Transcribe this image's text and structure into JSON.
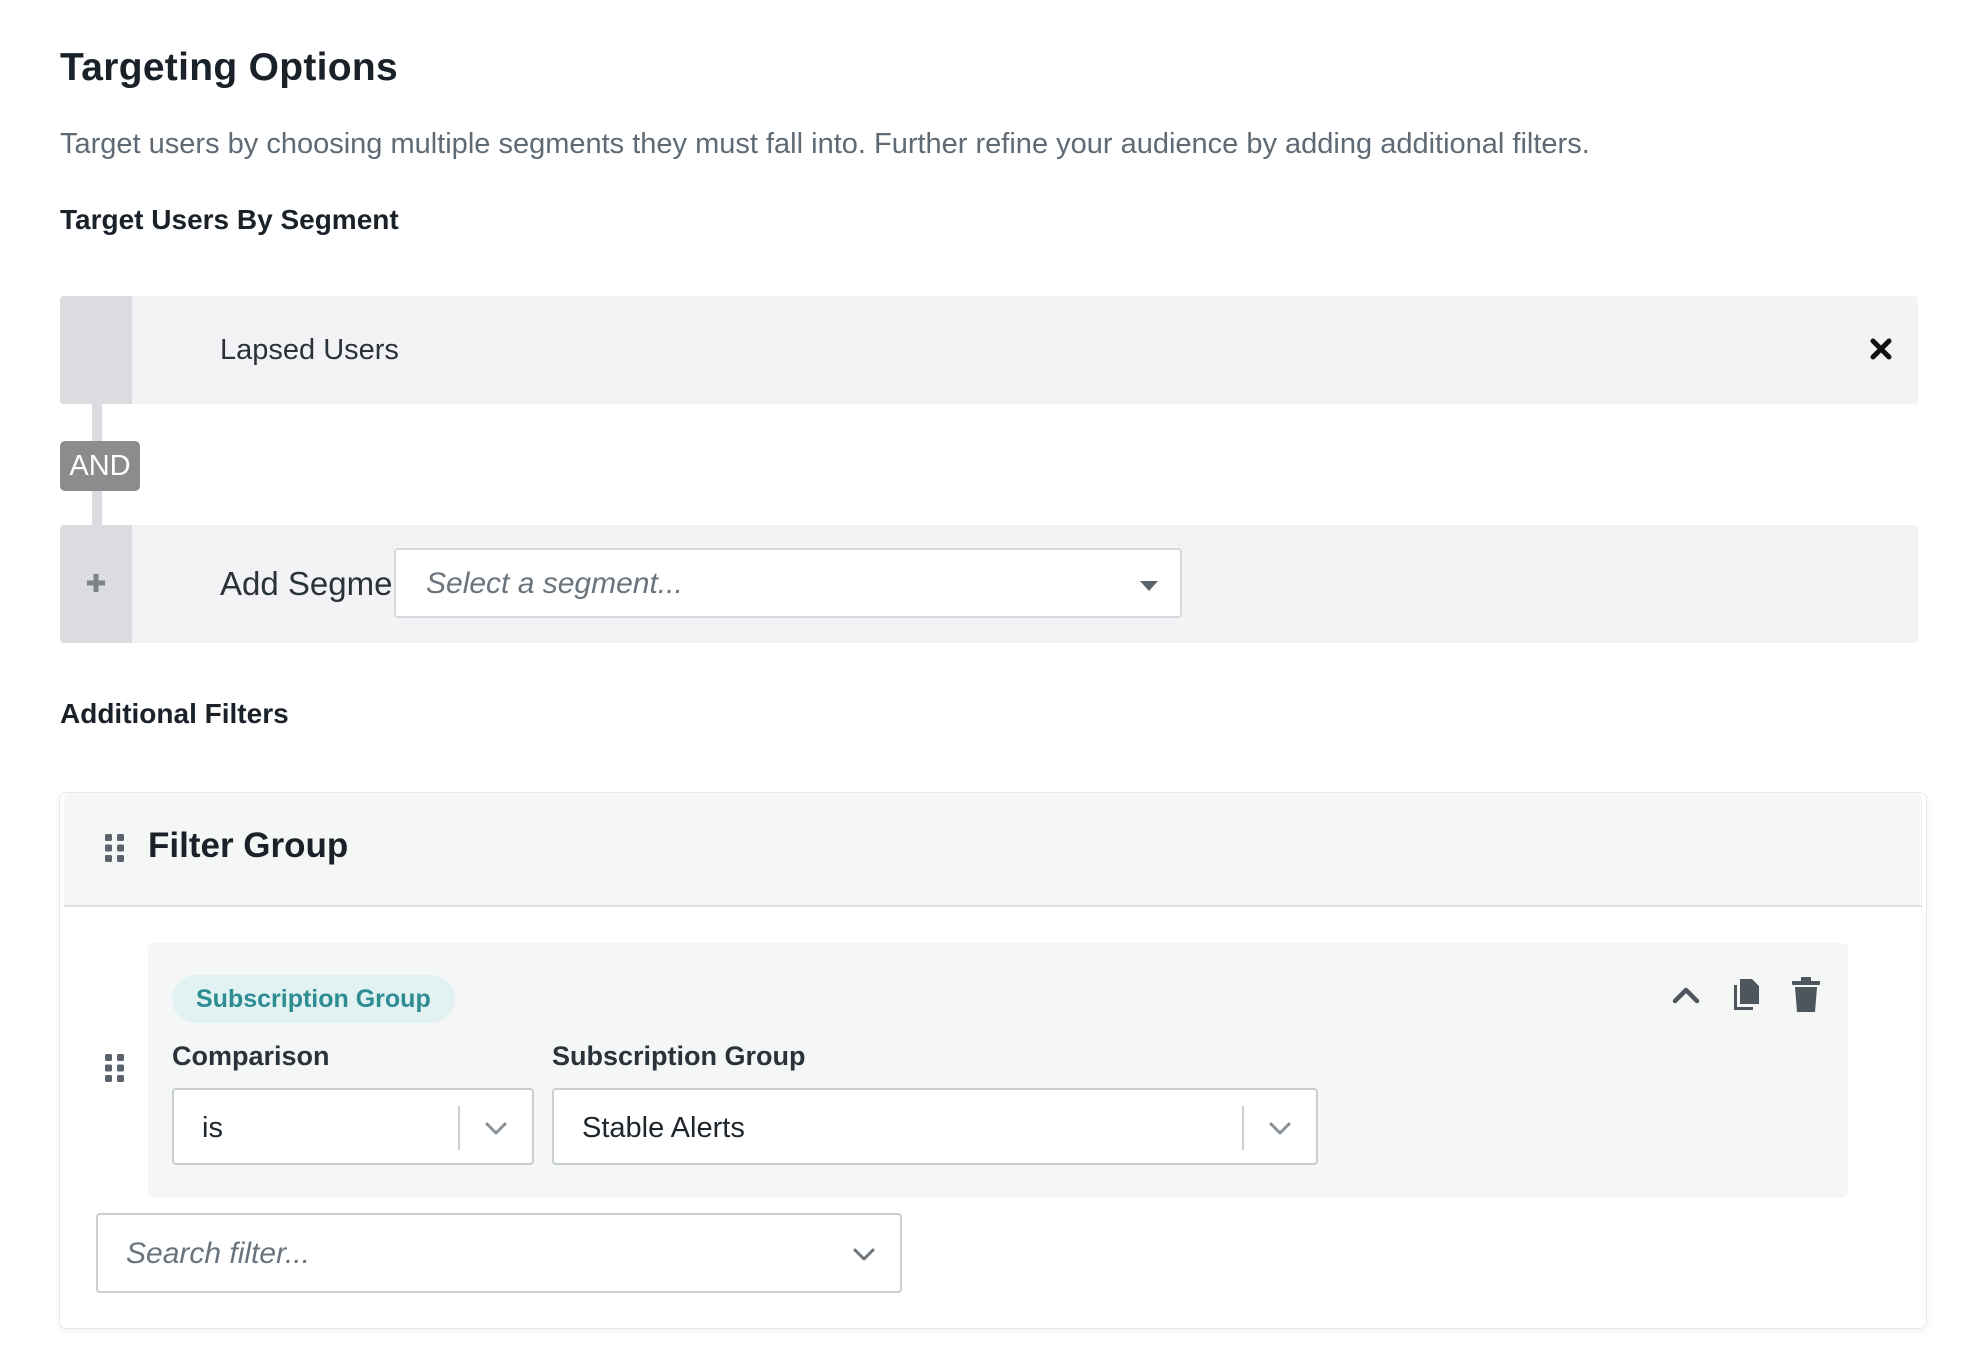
{
  "header": {
    "title": "Targeting Options",
    "description": "Target users by choosing multiple segments they must fall into. Further refine your audience by adding additional filters."
  },
  "segments": {
    "label": "Target Users By Segment",
    "selected": [
      {
        "name": "Lapsed Users",
        "remove_icon": "close-icon"
      }
    ],
    "connector": "AND",
    "add_label": "Add Segment",
    "select_placeholder": "Select a segment..."
  },
  "filters": {
    "label": "Additional Filters",
    "group": {
      "title": "Filter Group",
      "filter": {
        "type_pill": "Subscription Group",
        "comparison_label": "Comparison",
        "comparison_value": "is",
        "value_label": "Subscription Group",
        "value": "Stable Alerts",
        "actions": [
          "chevron-up-icon",
          "copy-icon",
          "trash-icon"
        ]
      }
    },
    "search_placeholder": "Search filter..."
  },
  "colors": {
    "accent_pill_bg": "#e2f1f2",
    "accent_pill_text": "#2d8d92",
    "and_badge": "#8c8c8f",
    "row_bg": "#f3f3f5"
  }
}
